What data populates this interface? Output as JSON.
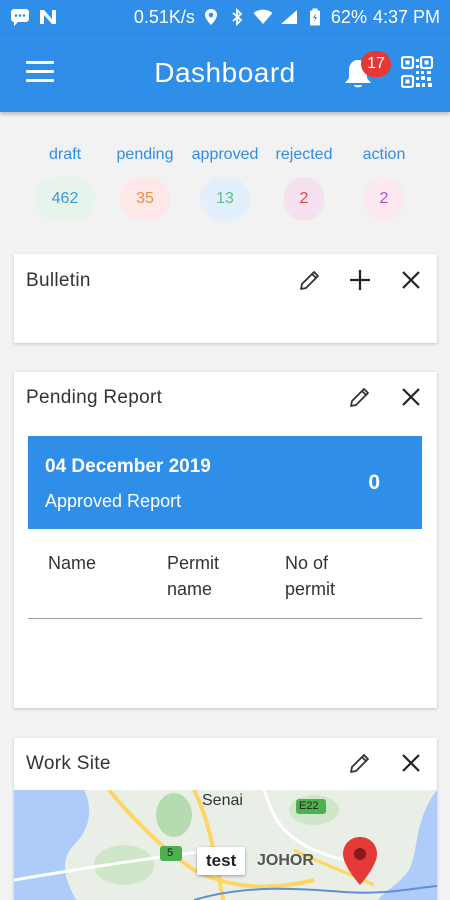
{
  "status_bar": {
    "speed": "0.51K/s",
    "battery": "62%",
    "time": "4:37 PM"
  },
  "app_bar": {
    "title": "Dashboard",
    "notification_count": "17"
  },
  "summary": [
    {
      "label": "draft",
      "value": "462",
      "color": "#3a9bd9",
      "bg": "#e6f4ea"
    },
    {
      "label": "pending",
      "value": "35",
      "color": "#e8923a",
      "bg": "#fde8e8"
    },
    {
      "label": "approved",
      "value": "13",
      "color": "#5bbf8a",
      "bg": "#e3f0fb"
    },
    {
      "label": "rejected",
      "value": "2",
      "color": "#e04545",
      "bg": "#f6e1f0"
    },
    {
      "label": "action",
      "value": "2",
      "color": "#b14fc3",
      "bg": "#fde8ef"
    }
  ],
  "bulletin": {
    "title": "Bulletin"
  },
  "pending_report": {
    "title": "Pending Report",
    "date": "04 December 2019",
    "subtitle": "Approved Report",
    "count": "0",
    "columns": [
      "Name",
      "Permit\nname",
      "No of\npermit"
    ]
  },
  "work_site": {
    "title": "Work Site",
    "marker_label": "test",
    "map_labels": {
      "senai": "Senai",
      "johor": "JOHOR",
      "e22": "E22",
      "route5": "5"
    }
  }
}
